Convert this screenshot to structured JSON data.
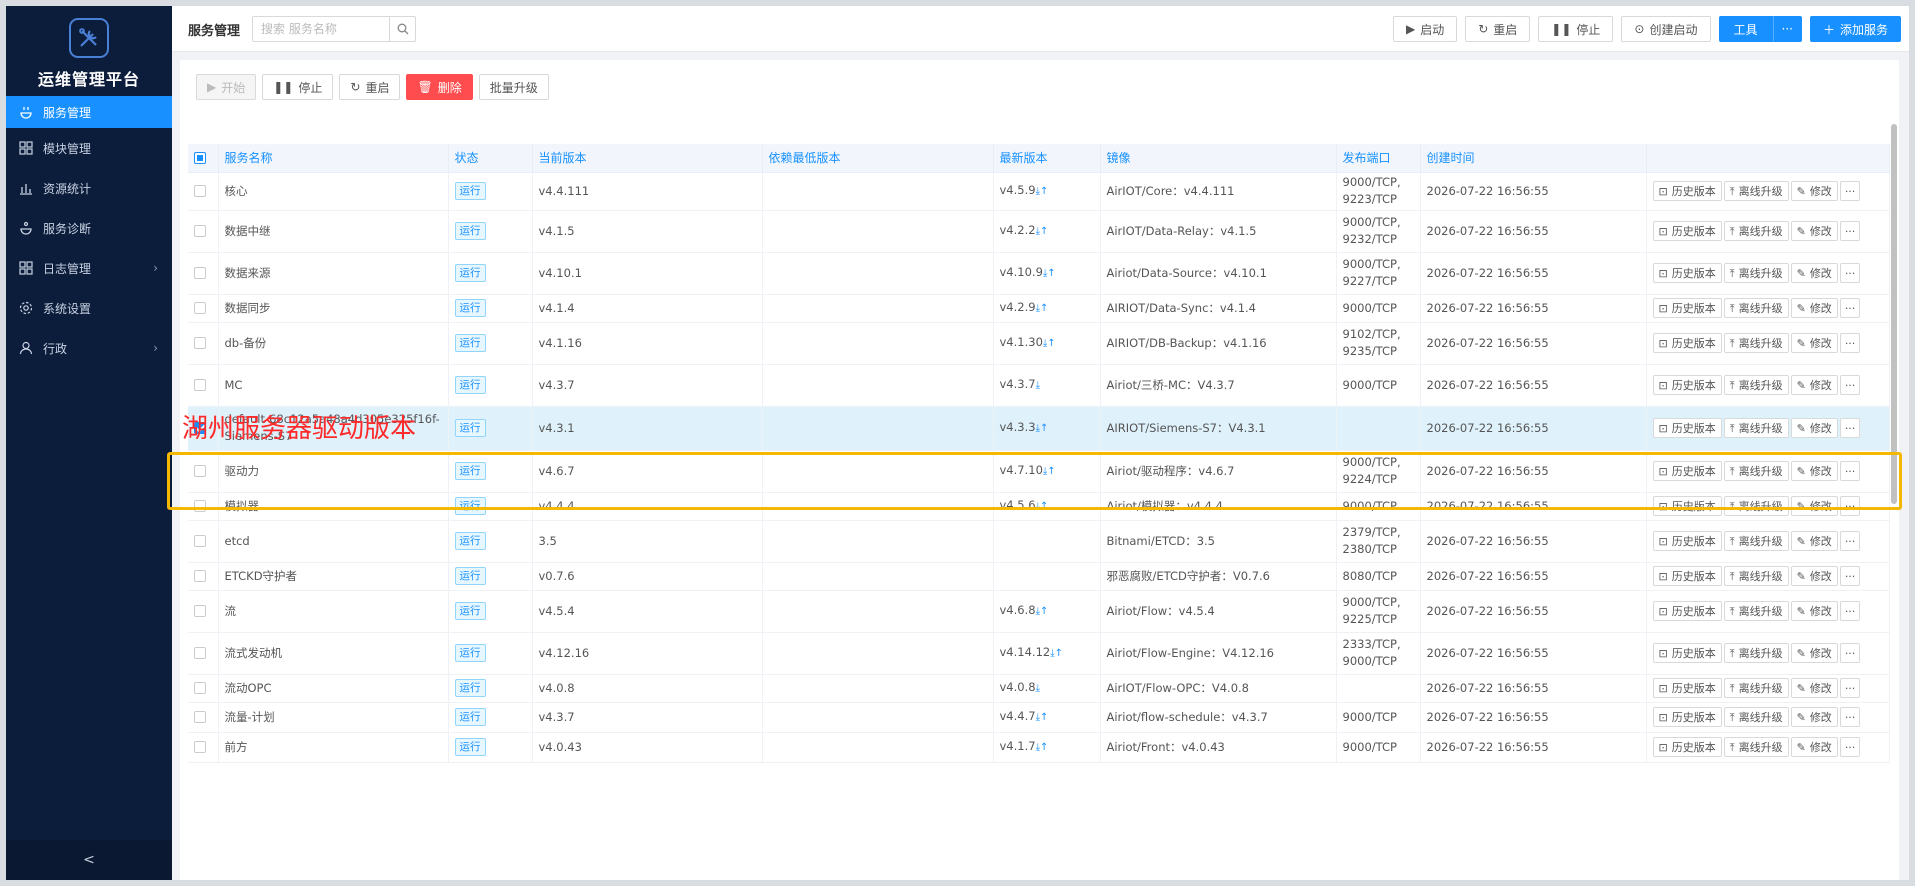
{
  "sidebar": {
    "title": "运维管理平台",
    "items": [
      {
        "label": "服务管理",
        "icon": "service-icon",
        "active": true,
        "arrow": false
      },
      {
        "label": "模块管理",
        "icon": "module-icon",
        "active": false,
        "arrow": false
      },
      {
        "label": "资源统计",
        "icon": "stats-icon",
        "active": false,
        "arrow": false
      },
      {
        "label": "服务诊断",
        "icon": "diagnose-icon",
        "active": false,
        "arrow": false
      },
      {
        "label": "日志管理",
        "icon": "log-icon",
        "active": false,
        "arrow": true
      },
      {
        "label": "系统设置",
        "icon": "gear-icon",
        "active": false,
        "arrow": false
      },
      {
        "label": "行政",
        "icon": "user-icon",
        "active": false,
        "arrow": true
      }
    ],
    "collapse_label": "<"
  },
  "topbar": {
    "title": "服务管理",
    "search_placeholder": "搜索 服务名称",
    "actions": {
      "start": "启动",
      "restart": "重启",
      "stop": "停止",
      "create_start": "创建启动",
      "tools": "工具",
      "tools_more": "···",
      "add": "添加服务"
    }
  },
  "actionbar": {
    "begin": "开始",
    "stop": "停止",
    "restart": "重启",
    "delete": "删除",
    "batch_upgrade": "批量升级"
  },
  "table": {
    "headers": [
      "服务名称",
      "状态",
      "当前版本",
      "依赖最低版本",
      "最新版本",
      "镜像",
      "发布端口",
      "创建时间"
    ],
    "ops": {
      "history": "历史版本",
      "offline": "离线升级",
      "edit": "修改",
      "more": "···"
    },
    "rows": [
      {
        "name": "核心",
        "status": "运行",
        "cur": "v4.4.111",
        "dep": "",
        "latest": "v4.5.9",
        "icons": "⤓↑",
        "image": "AirIOT/Core：v4.4.111",
        "port": "9000/TCP,\n9223/TCP",
        "created": "2026-07-22 16:56:55",
        "checked": false
      },
      {
        "name": "数据中继",
        "status": "运行",
        "cur": "v4.1.5",
        "dep": "",
        "latest": "v4.2.2",
        "icons": "⤓↑",
        "image": "AirIOT/Data-Relay：v4.1.5",
        "port": "9000/TCP,\n9232/TCP",
        "created": "2026-07-22 16:56:55",
        "checked": false
      },
      {
        "name": "数据来源",
        "status": "运行",
        "cur": "v4.10.1",
        "dep": "",
        "latest": "v4.10.9",
        "icons": "⤓↑",
        "image": "Airiot/Data-Source：v4.10.1",
        "port": "9000/TCP,\n9227/TCP",
        "created": "2026-07-22 16:56:55",
        "checked": false
      },
      {
        "name": "数据同步",
        "status": "运行",
        "cur": "v4.1.4",
        "dep": "",
        "latest": "v4.2.9",
        "icons": "⤓↑",
        "image": "AIRIOT/Data-Sync：v4.1.4",
        "port": "9000/TCP",
        "created": "2026-07-22 16:56:55",
        "checked": false
      },
      {
        "name": "db-备份",
        "status": "运行",
        "cur": "v4.1.16",
        "dep": "",
        "latest": "v4.1.30",
        "icons": "⤓↑",
        "image": "AIRIOT/DB-Backup：v4.1.16",
        "port": "9102/TCP,\n9235/TCP",
        "created": "2026-07-22 16:56:55",
        "checked": false
      },
      {
        "name": "MC",
        "status": "运行",
        "cur": "v4.3.7",
        "dep": "",
        "latest": "v4.3.7",
        "icons": "⤓",
        "image": "Airiot/三桥-MC：V4.3.7",
        "port": "9000/TCP",
        "created": "2026-07-22 16:56:55",
        "checked": false
      },
      {
        "name": "default-68c12a5a48a4d305e325f16f-\nSiemens-S7",
        "status": "运行",
        "cur": "v4.3.1",
        "dep": "",
        "latest": "v4.3.3",
        "icons": "⤓↑",
        "image": "AIRIOT/Siemens-S7：V4.3.1",
        "port": "",
        "created": "2026-07-22 16:56:55",
        "checked": true
      },
      {
        "name": "驱动力",
        "status": "运行",
        "cur": "v4.6.7",
        "dep": "",
        "latest": "v4.7.10",
        "icons": "⤓↑",
        "image": "Airiot/驱动程序：v4.6.7",
        "port": "9000/TCP,\n9224/TCP",
        "created": "2026-07-22 16:56:55",
        "checked": false
      },
      {
        "name": "模拟器",
        "status": "运行",
        "cur": "v4.4.4",
        "dep": "",
        "latest": "v4.5.6",
        "icons": "⤓↑",
        "image": "Airiot/模拟器：v4.4.4",
        "port": "9000/TCP",
        "created": "2026-07-22 16:56:55",
        "checked": false
      },
      {
        "name": "etcd",
        "status": "运行",
        "cur": "3.5",
        "dep": "",
        "latest": "",
        "icons": "",
        "image": "Bitnami/ETCD：3.5",
        "port": "2379/TCP,\n2380/TCP",
        "created": "2026-07-22 16:56:55",
        "checked": false
      },
      {
        "name": "ETCKD守护者",
        "status": "运行",
        "cur": "v0.7.6",
        "dep": "",
        "latest": "",
        "icons": "",
        "image": "邪恶腐败/ETCD守护者：V0.7.6",
        "port": "8080/TCP",
        "created": "2026-07-22 16:56:55",
        "checked": false
      },
      {
        "name": "流",
        "status": "运行",
        "cur": "v4.5.4",
        "dep": "",
        "latest": "v4.6.8",
        "icons": "⤓↑",
        "image": "Airiot/Flow：v4.5.4",
        "port": "9000/TCP,\n9225/TCP",
        "created": "2026-07-22 16:56:55",
        "checked": false
      },
      {
        "name": "流式发动机",
        "status": "运行",
        "cur": "v4.12.16",
        "dep": "",
        "latest": "v4.14.12",
        "icons": "⤓↑",
        "image": "Airiot/Flow-Engine：V4.12.16",
        "port": "2333/TCP,\n9000/TCP",
        "created": "2026-07-22 16:56:55",
        "checked": false
      },
      {
        "name": "流动OPC",
        "status": "运行",
        "cur": "v4.0.8",
        "dep": "",
        "latest": "v4.0.8",
        "icons": "⤓",
        "image": "AirIOT/Flow-OPC：V4.0.8",
        "port": "",
        "created": "2026-07-22 16:56:55",
        "checked": false
      },
      {
        "name": "流量-计划",
        "status": "运行",
        "cur": "v4.3.7",
        "dep": "",
        "latest": "v4.4.7",
        "icons": "⤓↑",
        "image": "Airiot/flow-schedule：v4.3.7",
        "port": "9000/TCP",
        "created": "2026-07-22 16:56:55",
        "checked": false
      },
      {
        "name": "前方",
        "status": "运行",
        "cur": "v4.0.43",
        "dep": "",
        "latest": "v4.1.7",
        "icons": "⤓↑",
        "image": "Airiot/Front：v4.0.43",
        "port": "9000/TCP",
        "created": "2026-07-22 16:56:55",
        "checked": false
      }
    ]
  },
  "annotation": {
    "text": "湖州服务器驱动版本",
    "color": "#ff2a2a",
    "box_color": "#f5b800"
  },
  "colors": {
    "accent": "#1890ff",
    "sidebar_bg": "#0c1d3b",
    "danger": "#ff4d4f"
  }
}
